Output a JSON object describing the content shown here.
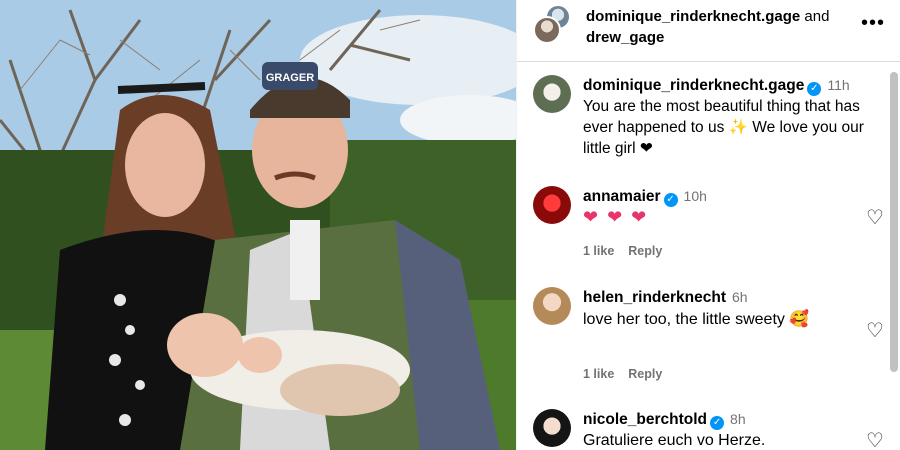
{
  "header": {
    "user1": "dominique_rinderknecht.gage",
    "joiner": "and",
    "user2": "drew_gage",
    "more_icon": "more-horizontal-icon"
  },
  "photo": {
    "cap_text": "GRAGER",
    "description_icon": "family-photo"
  },
  "comments": [
    {
      "username": "dominique_rinderknecht.gage",
      "verified": true,
      "time": "11h",
      "text": "You are the most beautiful thing that has ever happened to us ✨ We love you our little girl ❤",
      "likes": "",
      "reply": "",
      "has_like_icon": false
    },
    {
      "username": "annamaier",
      "verified": true,
      "time": "10h",
      "text": "❤ ❤ ❤",
      "likes": "1 like",
      "reply": "Reply",
      "has_like_icon": true
    },
    {
      "username": "helen_rinderknecht",
      "verified": false,
      "time": "6h",
      "text": "love her too, the little sweety 🥰",
      "likes": "1 like",
      "reply": "Reply",
      "has_like_icon": true
    },
    {
      "username": "nicole_berchtold",
      "verified": true,
      "time": "8h",
      "text": "Gratuliere euch vo Herze.",
      "likes": "",
      "reply": "",
      "has_like_icon": true
    }
  ],
  "colors": {
    "verified": "#0095f6",
    "meta_text": "#737373",
    "divider": "#dbdbdb"
  }
}
